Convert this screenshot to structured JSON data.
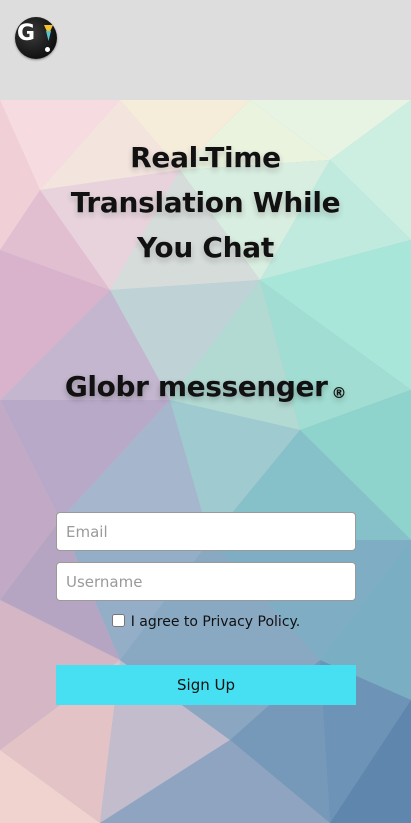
{
  "header": {
    "logo_letter": "G"
  },
  "hero": {
    "headline": "Real-Time Translation While You Chat",
    "brand_name": "Globr messenger",
    "brand_mark": "®"
  },
  "form": {
    "email_placeholder": "Email",
    "username_placeholder": "Username",
    "agree_label": "I agree to Privacy Policy.",
    "signup_label": "Sign Up"
  },
  "colors": {
    "header_bg": "#dddddd",
    "signup_button": "#47e0f2"
  },
  "icons": {
    "logo": "globr-logo-icon"
  }
}
